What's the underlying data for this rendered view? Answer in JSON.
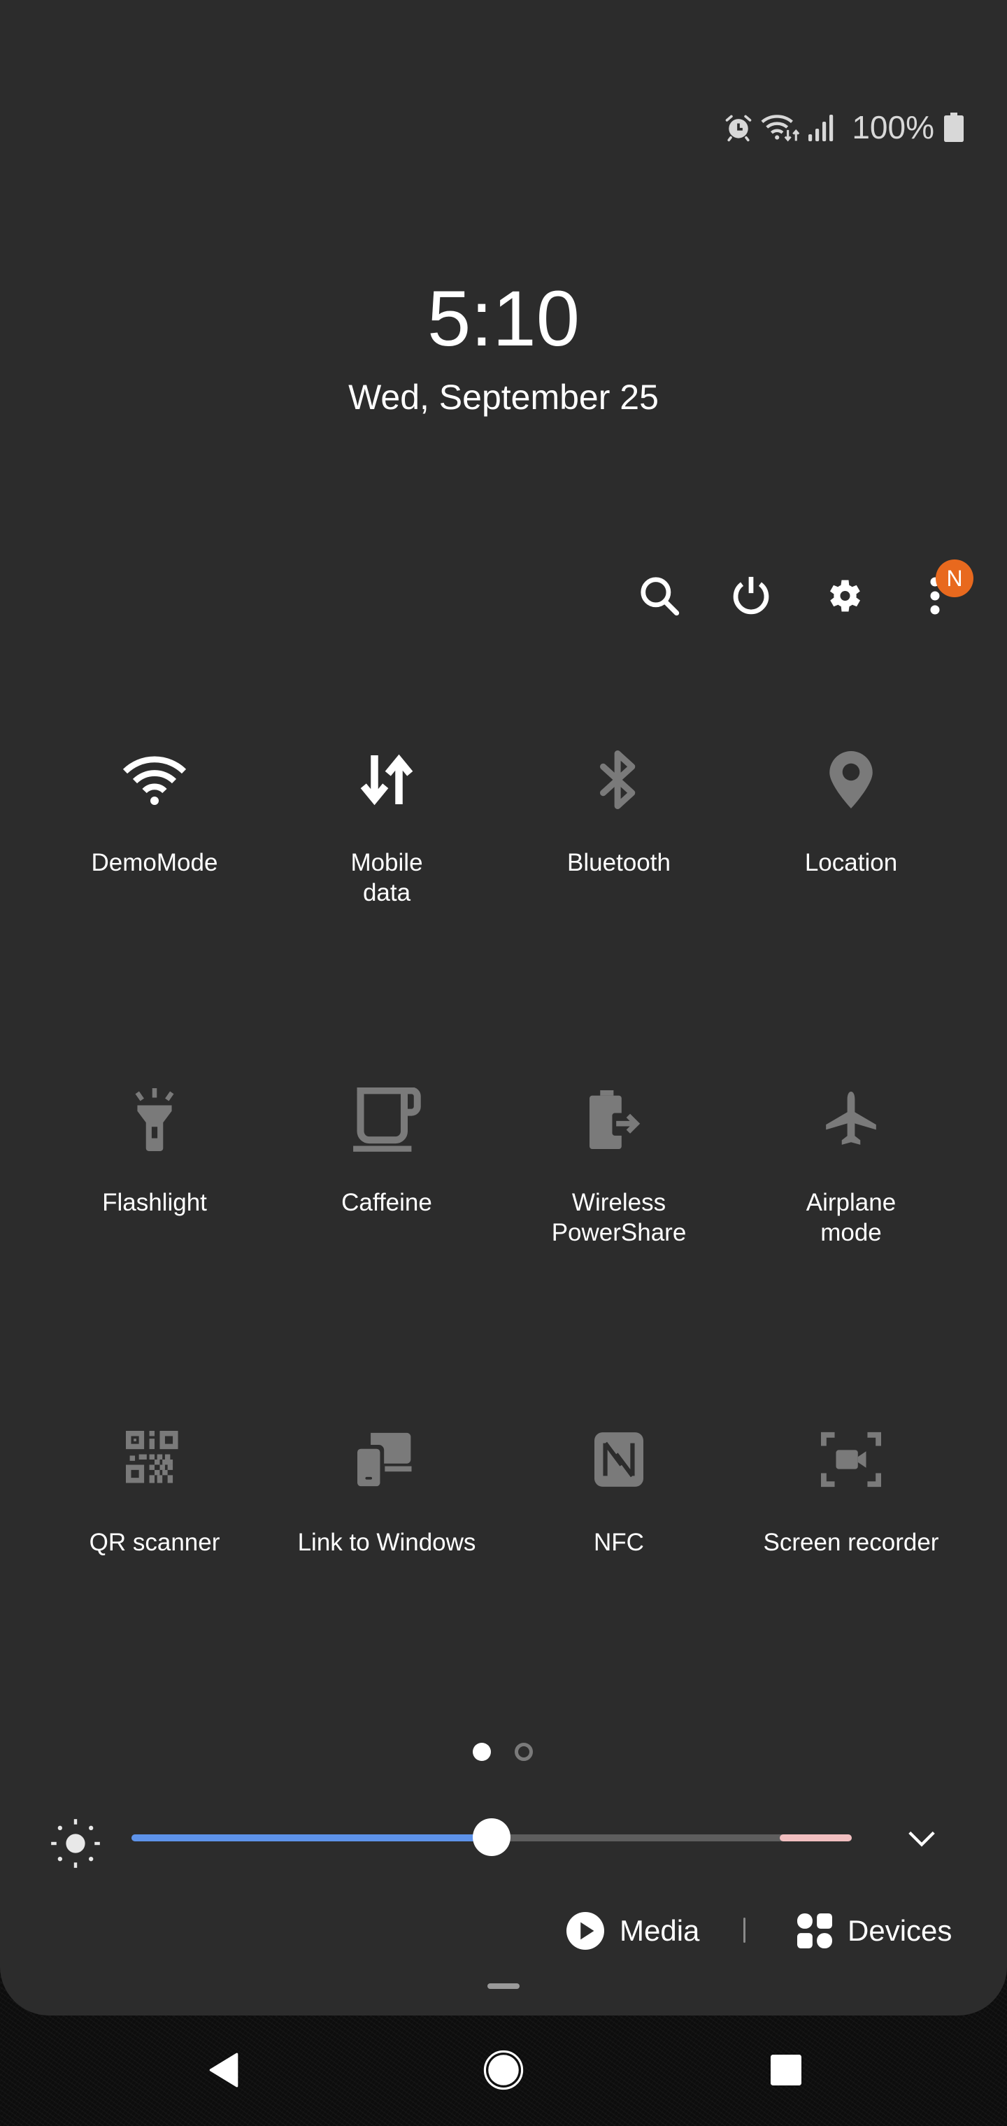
{
  "status_bar": {
    "icons": [
      "alarm-icon",
      "wifi-data-icon",
      "signal-icon",
      "battery-icon"
    ],
    "battery_percent": "100%"
  },
  "clock": {
    "time": "5:10",
    "date": "Wed, September 25"
  },
  "header_actions": [
    {
      "name": "search",
      "icon": "search-icon"
    },
    {
      "name": "power",
      "icon": "power-icon"
    },
    {
      "name": "settings",
      "icon": "gear-icon"
    },
    {
      "name": "more",
      "icon": "more-vertical-icon",
      "badge": "N"
    }
  ],
  "colors": {
    "panel_bg": "#2c2c2c",
    "active_icon": "#ffffff",
    "inactive_icon": "#7a7a7a",
    "badge": "#e8691e",
    "slider_fill": "#5e93ea",
    "slider_track": "#5e5e5e",
    "slider_warn": "#f1bfc0"
  },
  "tiles": [
    {
      "label": "DemoMode",
      "icon": "wifi-icon",
      "active": true
    },
    {
      "label": "Mobile\ndata",
      "icon": "mobile-data-icon",
      "active": true
    },
    {
      "label": "Bluetooth",
      "icon": "bluetooth-icon",
      "active": false
    },
    {
      "label": "Location",
      "icon": "location-icon",
      "active": false
    },
    {
      "label": "Flashlight",
      "icon": "flashlight-icon",
      "active": false
    },
    {
      "label": "Caffeine",
      "icon": "coffee-cup-icon",
      "active": false
    },
    {
      "label": "Wireless\nPowerShare",
      "icon": "battery-share-icon",
      "active": false
    },
    {
      "label": "Airplane\nmode",
      "icon": "airplane-icon",
      "active": false
    },
    {
      "label": "QR scanner",
      "icon": "qr-code-icon",
      "active": false
    },
    {
      "label": "Link to Windows",
      "icon": "link-to-windows-icon",
      "active": false
    },
    {
      "label": "NFC",
      "icon": "nfc-icon",
      "active": false
    },
    {
      "label": "Screen recorder",
      "icon": "screen-recorder-icon",
      "active": false
    }
  ],
  "pager": {
    "pages": 2,
    "current": 1
  },
  "brightness": {
    "level_percent": 50,
    "warning_zone_start_percent": 90
  },
  "media_bar": {
    "media_label": "Media",
    "devices_label": "Devices"
  },
  "nav_bar": {
    "buttons": [
      "back",
      "home",
      "recents"
    ]
  }
}
